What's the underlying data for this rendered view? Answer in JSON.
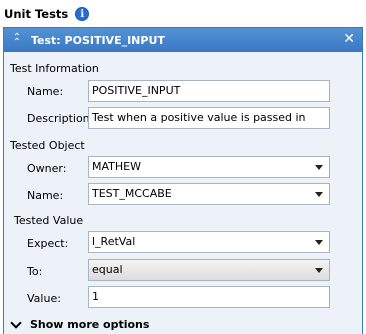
{
  "header": {
    "title": "Unit Tests",
    "info_icon": "info-icon"
  },
  "panel": {
    "title": "Test: POSITIVE_INPUT",
    "sections": {
      "test_information": {
        "label": "Test Information",
        "name_label": "Name:",
        "name_value": "POSITIVE_INPUT",
        "description_label": "Description:",
        "description_value": "Test when a positive value is passed in"
      },
      "tested_object": {
        "label": "Tested Object",
        "owner_label": "Owner:",
        "owner_value": "MATHEW",
        "name_label": "Name:",
        "name_value": "TEST_MCCABE"
      },
      "tested_value": {
        "label": "Tested Value",
        "expect_label": "Expect:",
        "expect_value": "l_RetVal",
        "to_label": "To:",
        "to_value": "equal",
        "value_label": "Value:",
        "value_value": "1"
      }
    },
    "show_more": "Show more options"
  },
  "colors": {
    "accent": "#3a78c4",
    "panel_bg": "#edf2f8",
    "info_icon": "#2b6bd6"
  }
}
